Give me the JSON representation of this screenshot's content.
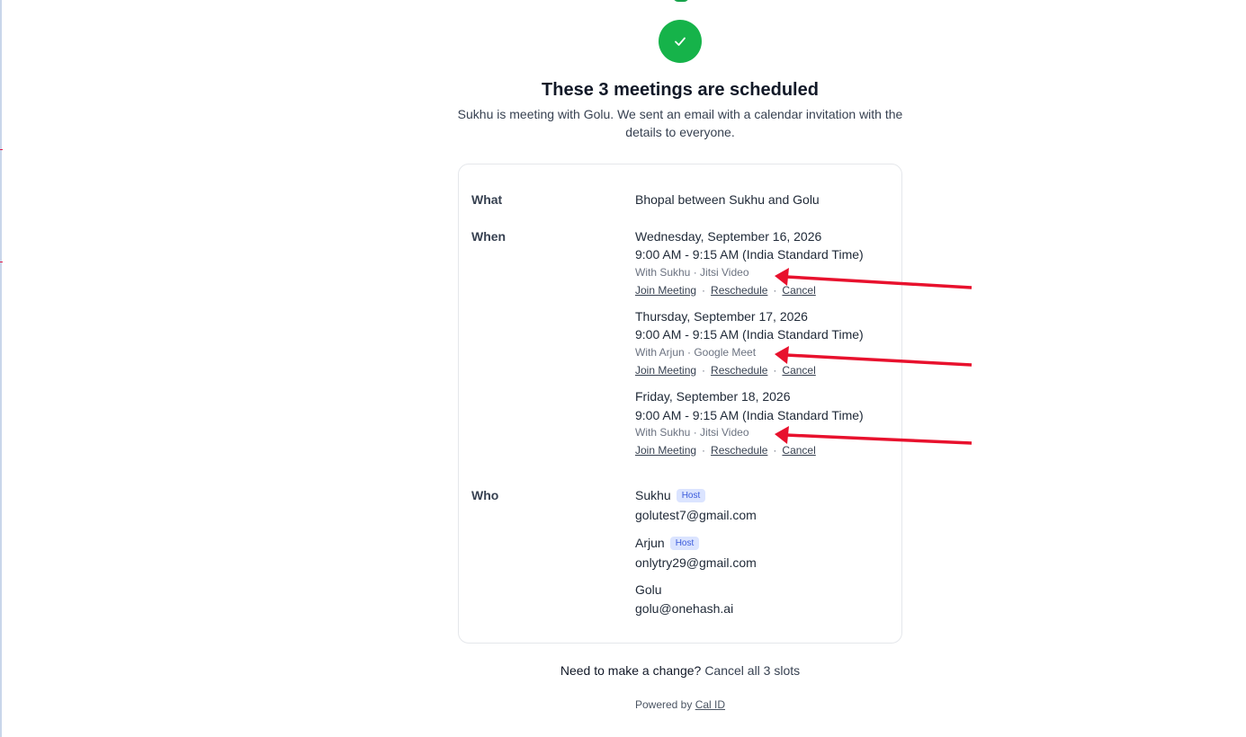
{
  "header": {
    "title": "These 3 meetings are scheduled",
    "subtitle": "Sukhu is meeting with Golu. We sent an email with a calendar invitation with the details to everyone."
  },
  "details": {
    "what_label": "What",
    "what_value": "Bhopal between Sukhu and Golu",
    "when_label": "When",
    "meetings": [
      {
        "date": "Wednesday, September 16, 2026",
        "time": "9:00 AM - 9:15 AM (India Standard Time)",
        "with": "With Sukhu · Jitsi Video"
      },
      {
        "date": "Thursday, September 17, 2026",
        "time": "9:00 AM - 9:15 AM (India Standard Time)",
        "with": "With Arjun · Google Meet"
      },
      {
        "date": "Friday, September 18, 2026",
        "time": "9:00 AM - 9:15 AM (India Standard Time)",
        "with": "With Sukhu · Jitsi Video"
      }
    ],
    "links": {
      "join": "Join Meeting",
      "reschedule": "Reschedule",
      "cancel": "Cancel",
      "separator": "·"
    },
    "who_label": "Who",
    "attendees": [
      {
        "name": "Sukhu",
        "badge": "Host",
        "email": "golutest7@gmail.com"
      },
      {
        "name": "Arjun",
        "badge": "Host",
        "email": "onlytry29@gmail.com"
      },
      {
        "name": "Golu",
        "email": "golu@onehash.ai"
      }
    ]
  },
  "footer": {
    "change_question": "Need to make a change?",
    "cancel_all": "Cancel all 3 slots",
    "powered_by": "Powered by",
    "brand": "Cal ID"
  },
  "icons": {
    "success": "check-icon",
    "annotation": "arrow-icon"
  },
  "colors": {
    "success": "#16b34a",
    "badge_bg": "#dbe4ff",
    "badge_text": "#3b5bdb",
    "annotation_arrow": "#e8112d"
  }
}
